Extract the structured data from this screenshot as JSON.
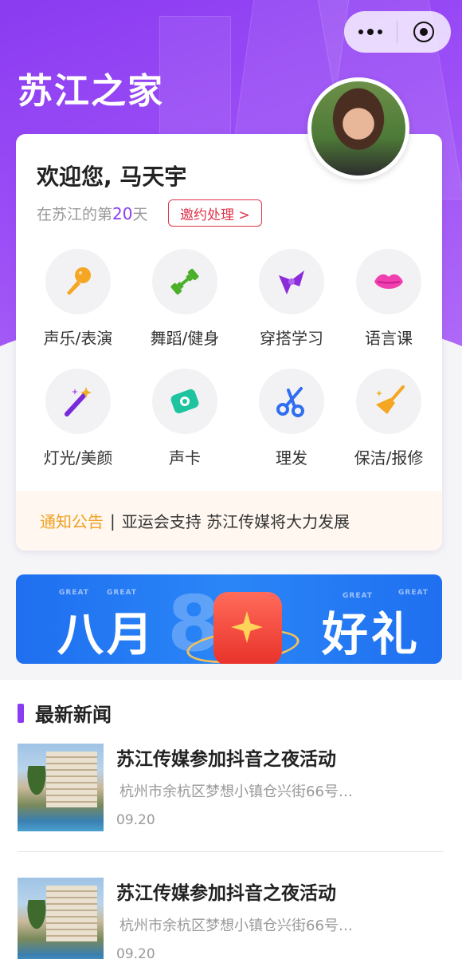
{
  "app": {
    "title": "苏江之家"
  },
  "capsule": {
    "more_icon": "more-dots-icon",
    "close_icon": "target-circle-icon"
  },
  "profile": {
    "greeting": "欢迎您, 马天宇",
    "days_prefix": "在苏江的第",
    "days_count": "20",
    "days_suffix": "天",
    "invite_label": "邀约处理 >"
  },
  "services": [
    {
      "label": "声乐/表演",
      "icon": "microphone-icon",
      "color": "#f5a623"
    },
    {
      "label": "舞蹈/健身",
      "icon": "dumbbell-icon",
      "color": "#4caf2a"
    },
    {
      "label": "穿搭学习",
      "icon": "bow-icon",
      "color": "#8b2bd9"
    },
    {
      "label": "语言课",
      "icon": "lips-icon",
      "color": "#f23fb0"
    },
    {
      "label": "灯光/美颜",
      "icon": "magic-wand-icon",
      "color": "#7a2bd9"
    },
    {
      "label": "声卡",
      "icon": "sound-card-icon",
      "color": "#1ec4a0"
    },
    {
      "label": "理发",
      "icon": "scissors-icon",
      "color": "#2f6ef0"
    },
    {
      "label": "保洁/报修",
      "icon": "broom-icon",
      "color": "#f5a623"
    }
  ],
  "notice": {
    "tag": "通知公告",
    "separator": "|",
    "text": "亚运会支持 苏江传媒将大力发展"
  },
  "banner": {
    "left_text": "八月",
    "right_text": "好礼",
    "number_text": "88",
    "deco_text": "GREAT"
  },
  "news": {
    "section_title": "最新新闻",
    "items": [
      {
        "title": "苏江传媒参加抖音之夜活动",
        "address": "杭州市余杭区梦想小镇仓兴街66号…",
        "date": "09.20"
      },
      {
        "title": "苏江传媒参加抖音之夜活动",
        "address": "杭州市余杭区梦想小镇仓兴街66号…",
        "date": "09.20"
      }
    ]
  }
}
